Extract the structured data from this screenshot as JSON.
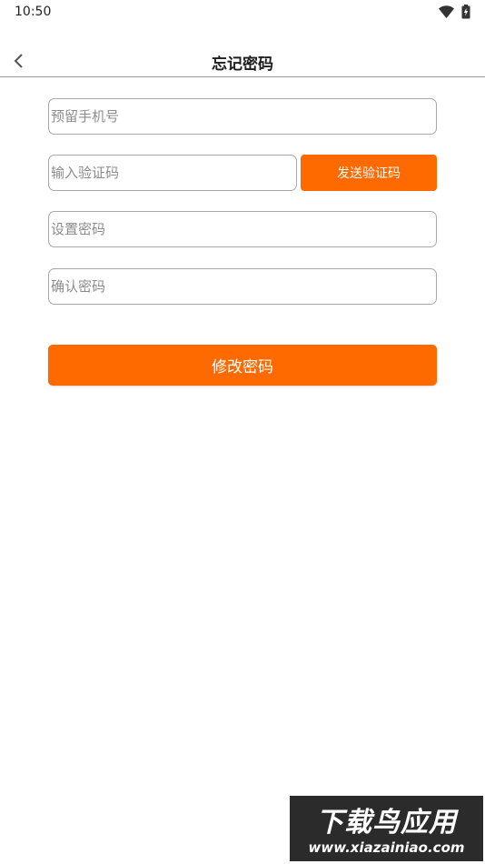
{
  "status_bar": {
    "time": "10:50",
    "icons": [
      "wifi-icon",
      "battery-icon"
    ]
  },
  "header": {
    "title": "忘记密码",
    "back_icon": "chevron-left-icon"
  },
  "form": {
    "phone": {
      "placeholder": "预留手机号",
      "value": ""
    },
    "code": {
      "placeholder": "输入验证码",
      "value": ""
    },
    "send_code_label": "发送验证码",
    "password": {
      "placeholder": "设置密码",
      "value": ""
    },
    "confirm_password": {
      "placeholder": "确认密码",
      "value": ""
    },
    "submit_label": "修改密码"
  },
  "watermark": {
    "title": "下载鸟应用",
    "url": "www.xiazainiao.com"
  },
  "colors": {
    "accent": "#ff6a00",
    "border": "#a8a8a8",
    "placeholder": "#8c8c8c",
    "watermark_bg": "#2b2b2b"
  }
}
